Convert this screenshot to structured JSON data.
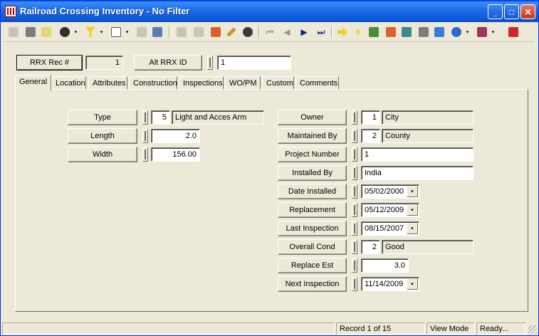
{
  "window": {
    "title": "Railroad Crossing Inventory - No Filter"
  },
  "header": {
    "rec_label": "RRX Rec #",
    "rec_value": "1",
    "alt_label": "Alt RRX ID",
    "alt_value": "1"
  },
  "tabs": [
    "General",
    "Location",
    "Attributes",
    "Construction",
    "Inspections",
    "WO/PM",
    "Custom",
    "Comments"
  ],
  "left_fields": {
    "type": {
      "label": "Type",
      "code": "5",
      "value": "Light and Acces Arm"
    },
    "length": {
      "label": "Length",
      "value": "2.0"
    },
    "width": {
      "label": "Width",
      "value": "156.00"
    }
  },
  "right_fields": {
    "owner": {
      "label": "Owner",
      "code": "1",
      "value": "City"
    },
    "maintained_by": {
      "label": "Maintained By",
      "code": "2",
      "value": "County"
    },
    "project_number": {
      "label": "Project Number",
      "value": "1"
    },
    "installed_by": {
      "label": "Installed By",
      "value": "India"
    },
    "date_installed": {
      "label": "Date Installed",
      "value": "05/02/2000"
    },
    "replacement": {
      "label": "Replacement",
      "value": "05/12/2009"
    },
    "last_inspection": {
      "label": "Last Inspection",
      "value": "08/15/2007"
    },
    "overall_cond": {
      "label": "Overall Cond",
      "code": "2",
      "value": "Good"
    },
    "replace_est": {
      "label": "Replace Est",
      "value": "3.0"
    },
    "next_inspection": {
      "label": "Next Inspection",
      "value": "11/14/2009"
    }
  },
  "status": {
    "record": "Record 1 of 15",
    "mode": "View Mode",
    "state": "Ready..."
  },
  "icons": {
    "dropdown": "▾",
    "minimize": "_",
    "maximize": "□",
    "close": "✕",
    "first": "⏮",
    "prev": "◀",
    "next": "▶",
    "last": "⏭"
  },
  "colors": {
    "titlebar": "#0a58d8",
    "face": "#ece9d8"
  }
}
